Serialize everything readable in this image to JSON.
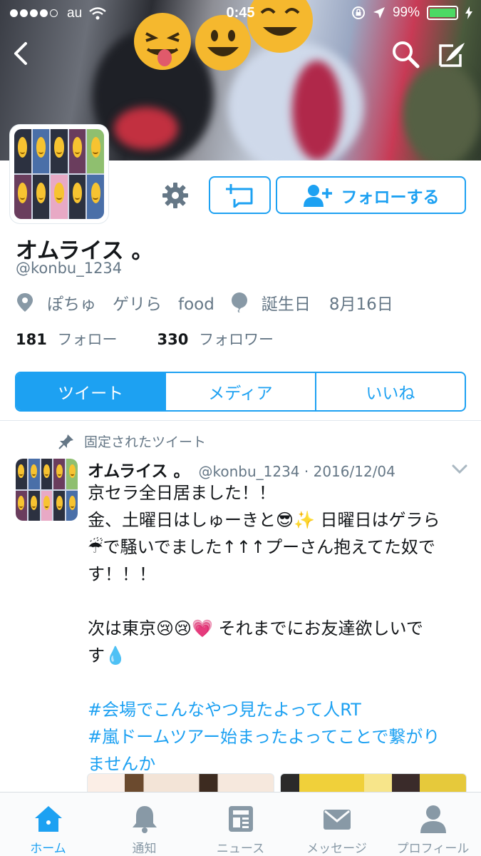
{
  "status_bar": {
    "carrier": "au",
    "time": "0:45",
    "battery": "99%",
    "battery_level": 0.99
  },
  "header": {
    "back_icon": "chevron-left-icon",
    "search_icon": "search-icon",
    "compose_icon": "compose-icon"
  },
  "profile": {
    "display_name": "オムライス 。",
    "handle": "@konbu_1234",
    "location": "ぽちゅ　ゲリら　food",
    "birthday_label": "誕生日",
    "birthday": "8月16日",
    "following_count": "181",
    "following_label": "フォロー",
    "followers_count": "330",
    "followers_label": "フォロワー",
    "follow_button": "フォローする"
  },
  "tabs": [
    {
      "label": "ツイート",
      "active": true
    },
    {
      "label": "メディア",
      "active": false
    },
    {
      "label": "いいね",
      "active": false
    }
  ],
  "tweet": {
    "pinned_label": "固定されたツイート",
    "author_name": "オムライス 。",
    "author_meta": "@konbu_1234 · 2016/12/04",
    "lines": [
      "京セラ全日居ました！！",
      "金、土曜日はしゅーきと😎✨ 日曜日はゲラら",
      "☔で騒いでました↑↑↑プーさん抱えてた奴で",
      "す！！！"
    ],
    "lines2": [
      "次は東京😢😢💗 それまでにお友達欲しいで",
      "す💧"
    ],
    "hashtags": [
      "#会場でこんなやつ見たよって人RT",
      "#嵐ドームツアー始まったよってことで繋がり",
      "ませんか"
    ]
  },
  "tabbar": [
    {
      "label": "ホーム",
      "icon": "home-icon",
      "active": true
    },
    {
      "label": "通知",
      "icon": "bell-icon",
      "active": false
    },
    {
      "label": "ニュース",
      "icon": "news-icon",
      "active": false
    },
    {
      "label": "メッセージ",
      "icon": "envelope-icon",
      "active": false
    },
    {
      "label": "プロフィール",
      "icon": "person-icon",
      "active": false
    }
  ],
  "colors": {
    "accent": "#1da1f2",
    "muted": "#657786",
    "battery": "#4cd964"
  }
}
